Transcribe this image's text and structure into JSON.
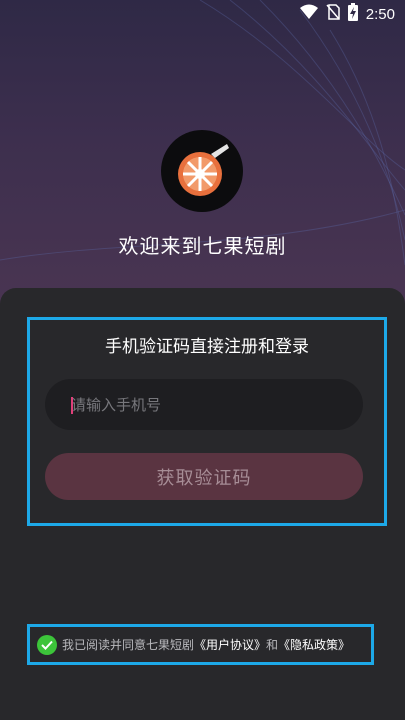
{
  "status_bar": {
    "time": "2:50",
    "icons": [
      "wifi-icon",
      "no-sim-icon",
      "battery-charging-icon"
    ]
  },
  "app": {
    "logo_icon": "wheel-logo-icon",
    "welcome": "欢迎来到七果短剧"
  },
  "login_form": {
    "title": "手机验证码直接注册和登录",
    "phone_input": {
      "value": "",
      "placeholder": "请输入手机号"
    },
    "get_code_button": "获取验证码"
  },
  "agreement": {
    "checked_icon": "check-circle-icon",
    "prefix": "我已阅读并同意七果短剧",
    "user_agreement": "《用户协议》",
    "conjunction": "和",
    "privacy_policy": "《隐私政策》"
  },
  "colors": {
    "accent_border": "#1da9e8",
    "button_bg": "#5a3441",
    "check_green": "#3cc43a",
    "caret": "#e0407a"
  }
}
